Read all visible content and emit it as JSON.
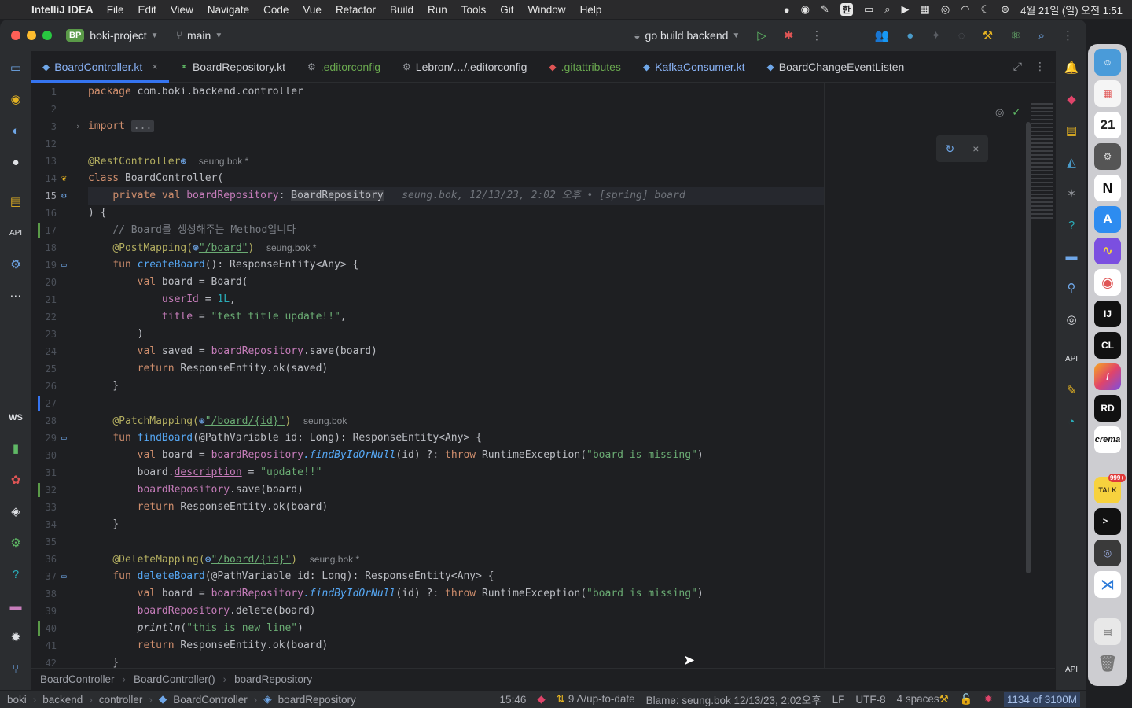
{
  "menubar": {
    "app_name": "IntelliJ IDEA",
    "items": [
      "File",
      "Edit",
      "View",
      "Navigate",
      "Code",
      "Vue",
      "Refactor",
      "Build",
      "Run",
      "Tools",
      "Git",
      "Window",
      "Help"
    ],
    "input_source": "한",
    "clock": "4월 21일 (일) 오전 1:51"
  },
  "titlebar": {
    "project_badge": "BP",
    "project": "boki-project",
    "branch": "main",
    "run_config": "go build backend"
  },
  "tabs": [
    {
      "label": "BoardController.kt",
      "active": true
    },
    {
      "label": "BoardRepository.kt"
    },
    {
      "label": ".editorconfig"
    },
    {
      "label": "Lebron/…/.editorconfig"
    },
    {
      "label": ".gitattributes"
    },
    {
      "label": "KafkaConsumer.kt"
    },
    {
      "label": "BoardChangeEventListen"
    }
  ],
  "editor": {
    "line_numbers": [
      "1",
      "2",
      "3",
      "12",
      "13",
      "14",
      "15",
      "16",
      "17",
      "18",
      "19",
      "20",
      "21",
      "22",
      "23",
      "24",
      "25",
      "26",
      "27",
      "28",
      "29",
      "30",
      "31",
      "32",
      "33",
      "34",
      "35",
      "36",
      "37",
      "38",
      "39",
      "40",
      "41",
      "42"
    ],
    "current_line": "15",
    "author_hint": "seung.bok *",
    "author_hint_plain": "seung.bok",
    "blame_inline": "seung.bok, 12/13/23, 2:02 오후 • [spring] board",
    "code": {
      "l1_kw": "package",
      "l1_rest": " com.boki.backend.controller",
      "l3_kw": "import",
      "l3_fold": "...",
      "l13": "@RestController",
      "l14_kw": "class",
      "l14_rest": " BoardController(",
      "l15_kw": "private val",
      "l15_prop": " boardRepository",
      "l15_sep": ": ",
      "l15_type": "BoardRepository",
      "l16": ") {",
      "l17": "// Board를 생성해주는 Method입니다",
      "l18_ann": "@PostMapping(",
      "l18_str": "\"/board\"",
      "l18_close": ")",
      "l19_kw": "fun",
      "l19_fn": " createBoard",
      "l19_rest": "(): ResponseEntity<Any> {",
      "l20_kw": "val",
      "l20_rest": " board = Board(",
      "l21_prop": "userId",
      "l21_eq": " = ",
      "l21_num": "1L",
      "l21_end": ",",
      "l22_prop": "title",
      "l22_eq": " = ",
      "l22_str": "\"test title update!!\"",
      "l22_end": ",",
      "l23": ")",
      "l24_kw": "val",
      "l24_rest": " saved = ",
      "l24_prop": "boardRepository",
      "l24_call": ".save(board)",
      "l25_kw": "return",
      "l25_rest": " ResponseEntity.ok(saved)",
      "l26": "}",
      "l28_ann": "@PatchMapping(",
      "l28_str": "\"/board/{id}\"",
      "l28_close": ")",
      "l29_kw": "fun",
      "l29_fn": " findBoard",
      "l29_rest": "(@PathVariable id: Long): ResponseEntity<Any> {",
      "l30_kw": "val",
      "l30_rest": " board = ",
      "l30_prop": "boardRepository",
      "l30_ext": ".findByIdOrNull",
      "l30_mid": "(id) ?: ",
      "l30_kw2": "throw",
      "l30_rest2": " RuntimeException(",
      "l30_str": "\"board is missing\"",
      "l30_end": ")",
      "l31_a": "board.",
      "l31_prop": "description",
      "l31_eq": " = ",
      "l31_str": "\"update!!\"",
      "l32_prop": "boardRepository",
      "l32_call": ".save(board)",
      "l33_kw": "return",
      "l33_rest": " ResponseEntity.ok(board)",
      "l34": "}",
      "l36_ann": "@DeleteMapping(",
      "l36_str": "\"/board/{id}\"",
      "l36_close": ")",
      "l37_kw": "fun",
      "l37_fn": " deleteBoard",
      "l37_rest": "(@PathVariable id: Long): ResponseEntity<Any> {",
      "l38_kw": "val",
      "l38_rest": " board = ",
      "l38_prop": "boardRepository",
      "l38_ext": ".findByIdOrNull",
      "l38_mid": "(id) ?: ",
      "l38_kw2": "throw",
      "l38_rest2": " RuntimeException(",
      "l38_str": "\"board is missing\"",
      "l38_end": ")",
      "l39_prop": "boardRepository",
      "l39_call": ".delete(board)",
      "l40_fn": "println",
      "l40_open": "(",
      "l40_str": "\"this is new line\"",
      "l40_close": ")",
      "l41_kw": "return",
      "l41_rest": " ResponseEntity.ok(board)",
      "l42": "}"
    }
  },
  "breadcrumb": [
    "BoardController",
    "BoardController()",
    "boardRepository"
  ],
  "left_strip": {
    "ws_label": "WS"
  },
  "statusbar": {
    "nav": [
      "boki",
      "backend",
      "controller",
      "BoardController",
      "boardRepository"
    ],
    "position": "15:46",
    "vcs": "9 Δ/up-to-date",
    "blame": "Blame: seung.bok 12/13/23, 2:02오후",
    "line_sep": "LF",
    "encoding": "UTF-8",
    "indent": "4 spaces",
    "memory": "1134 of 3100M"
  },
  "dock": {
    "calendar_day": "21",
    "notion": "N",
    "intellij": "IJ",
    "clion": "CL",
    "rider": "RD",
    "crema": "crema",
    "talk": "TALK",
    "talk_badge": "999+"
  },
  "colors": {
    "accent": "#3574f0",
    "keyword": "#cf8e6d",
    "function": "#56a8f5",
    "string": "#6aab73",
    "annotation": "#b3ae60",
    "property": "#c77dbb",
    "vcs_added": "#5a9a48",
    "vcs_modified": "#3574f0"
  }
}
